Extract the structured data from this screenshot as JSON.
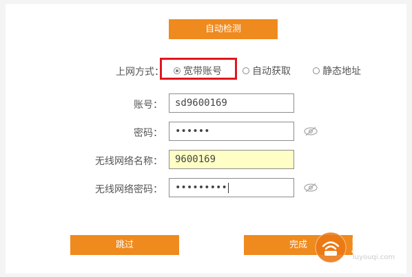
{
  "buttons": {
    "auto_detect": "自动检测",
    "skip": "跳过",
    "finish": "完成"
  },
  "connection": {
    "label": "上网方式：",
    "options": [
      {
        "label": "宽带账号",
        "selected": true
      },
      {
        "label": "自动获取",
        "selected": false
      },
      {
        "label": "静态地址",
        "selected": false
      }
    ]
  },
  "fields": {
    "account": {
      "label": "账号：",
      "value": "sd9600169"
    },
    "password": {
      "label": "密码：",
      "value": "••••••"
    },
    "wifi_name": {
      "label": "无线网络名称：",
      "value": "9600169"
    },
    "wifi_password": {
      "label": "无线网络密码：",
      "value": "•••••••••"
    }
  },
  "watermark": {
    "text": "路由器",
    "sub": "luyouqi.com"
  },
  "colors": {
    "accent": "#ef8a1e",
    "highlight": "#e0161c",
    "wifi_name_bg": "#fefec6"
  },
  "icons": {
    "eye": "eye-slash-icon",
    "watermark": "router-icon"
  }
}
